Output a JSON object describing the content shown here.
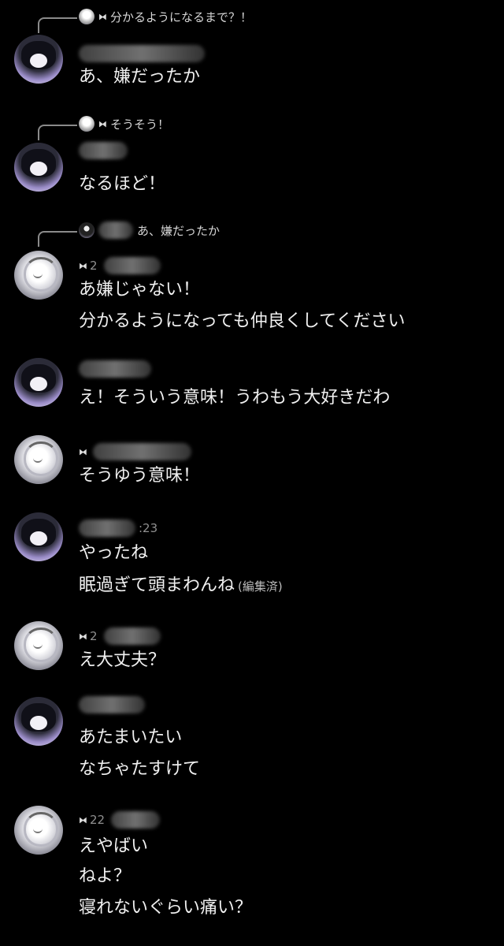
{
  "messages": [
    {
      "reply_icon": "⧓",
      "reply_text": "分かるようになるまで？！",
      "lines": [
        "あ、嫌だったか"
      ]
    },
    {
      "reply_icon": "⧓",
      "reply_text": "そうそう！",
      "lines": [
        "なるほど！"
      ]
    },
    {
      "reply_text": "あ、嫌だったか",
      "header_icon": "⧓",
      "header_time": "2",
      "lines": [
        "あ嫌じゃない！",
        "分かるようになっても仲良くしてください"
      ]
    },
    {
      "lines": [
        "え！そういう意味！うわもう大好きだわ"
      ]
    },
    {
      "header_icon": "⧓",
      "lines": [
        "そうゆう意味！"
      ]
    },
    {
      "header_time": ":23",
      "lines": [
        "やったね",
        "眠過ぎて頭まわんね"
      ],
      "edited": "(編集済)"
    },
    {
      "header_icon": "⧓",
      "header_time": "2",
      "lines": [
        "え大丈夫？"
      ]
    },
    {
      "lines": [
        "あたまいたい",
        "なちゃたすけて"
      ]
    },
    {
      "header_icon": "⧓",
      "header_time": "22",
      "lines": [
        "えやばい",
        "ねよ？",
        "寝れないぐらい痛い？"
      ]
    }
  ],
  "icons": [
    "avatar",
    "mini-avatar",
    "bowtie-icon"
  ]
}
